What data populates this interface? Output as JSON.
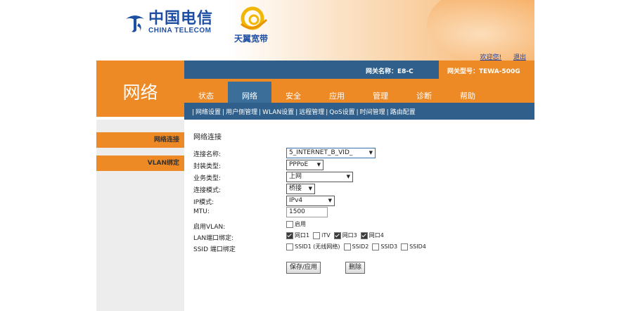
{
  "header": {
    "brand_cn": "中国电信",
    "brand_en": "CHINA TELECOM",
    "sub_brand": "天翼宽带",
    "user_links": [
      "欢迎您!",
      "退出"
    ]
  },
  "device": {
    "name": "网关名称：E8-C",
    "model": "网关型号：TEWA-500G"
  },
  "section_title": "网络",
  "tabs": [
    {
      "label": "状态",
      "active": false
    },
    {
      "label": "网络",
      "active": true
    },
    {
      "label": "安全",
      "active": false
    },
    {
      "label": "应用",
      "active": false
    },
    {
      "label": "管理",
      "active": false
    },
    {
      "label": "诊断",
      "active": false
    },
    {
      "label": "帮助",
      "active": false
    }
  ],
  "subnav": [
    "网络设置",
    "用户侧管理",
    "WLAN设置",
    "远程管理",
    "QoS设置",
    "时间管理",
    "路由配置"
  ],
  "left_menu": [
    "网络连接",
    "VLAN绑定"
  ],
  "form": {
    "title": "网络连接",
    "connection_name": {
      "label": "连接名称:",
      "value": "5_INTERNET_B_VID_"
    },
    "encap_type": {
      "label": "封装类型:",
      "value": "PPPoE"
    },
    "service_type": {
      "label": "业务类型:",
      "value": "上网"
    },
    "connection_mode": {
      "label": "连接模式:",
      "value": "桥接"
    },
    "ip_mode": {
      "label": "IP模式:",
      "value": "IPv4"
    },
    "mtu": {
      "label": "MTU:",
      "value": "1500"
    },
    "vlan": {
      "label": "启用VLAN:",
      "option": "启用",
      "checked": false
    },
    "lan_binding": {
      "label": "LAN端口绑定:",
      "ports": [
        {
          "label": "网口1",
          "checked": true
        },
        {
          "label": "iTV",
          "checked": false
        },
        {
          "label": "网口3",
          "checked": true
        },
        {
          "label": "网口4",
          "checked": true
        }
      ]
    },
    "ssid_binding": {
      "label": "SSID 端口绑定",
      "ssids": [
        {
          "label": "SSID1 (无线网络)",
          "checked": false
        },
        {
          "label": "SSID2",
          "checked": false
        },
        {
          "label": "SSID3",
          "checked": false
        },
        {
          "label": "SSID4",
          "checked": false
        }
      ]
    },
    "save_label": "保存/应用",
    "delete_label": "删除"
  },
  "colors": {
    "orange": "#ee8a26",
    "blue_bar": "#2f5f8a",
    "brand_blue": "#1e4fa3"
  }
}
